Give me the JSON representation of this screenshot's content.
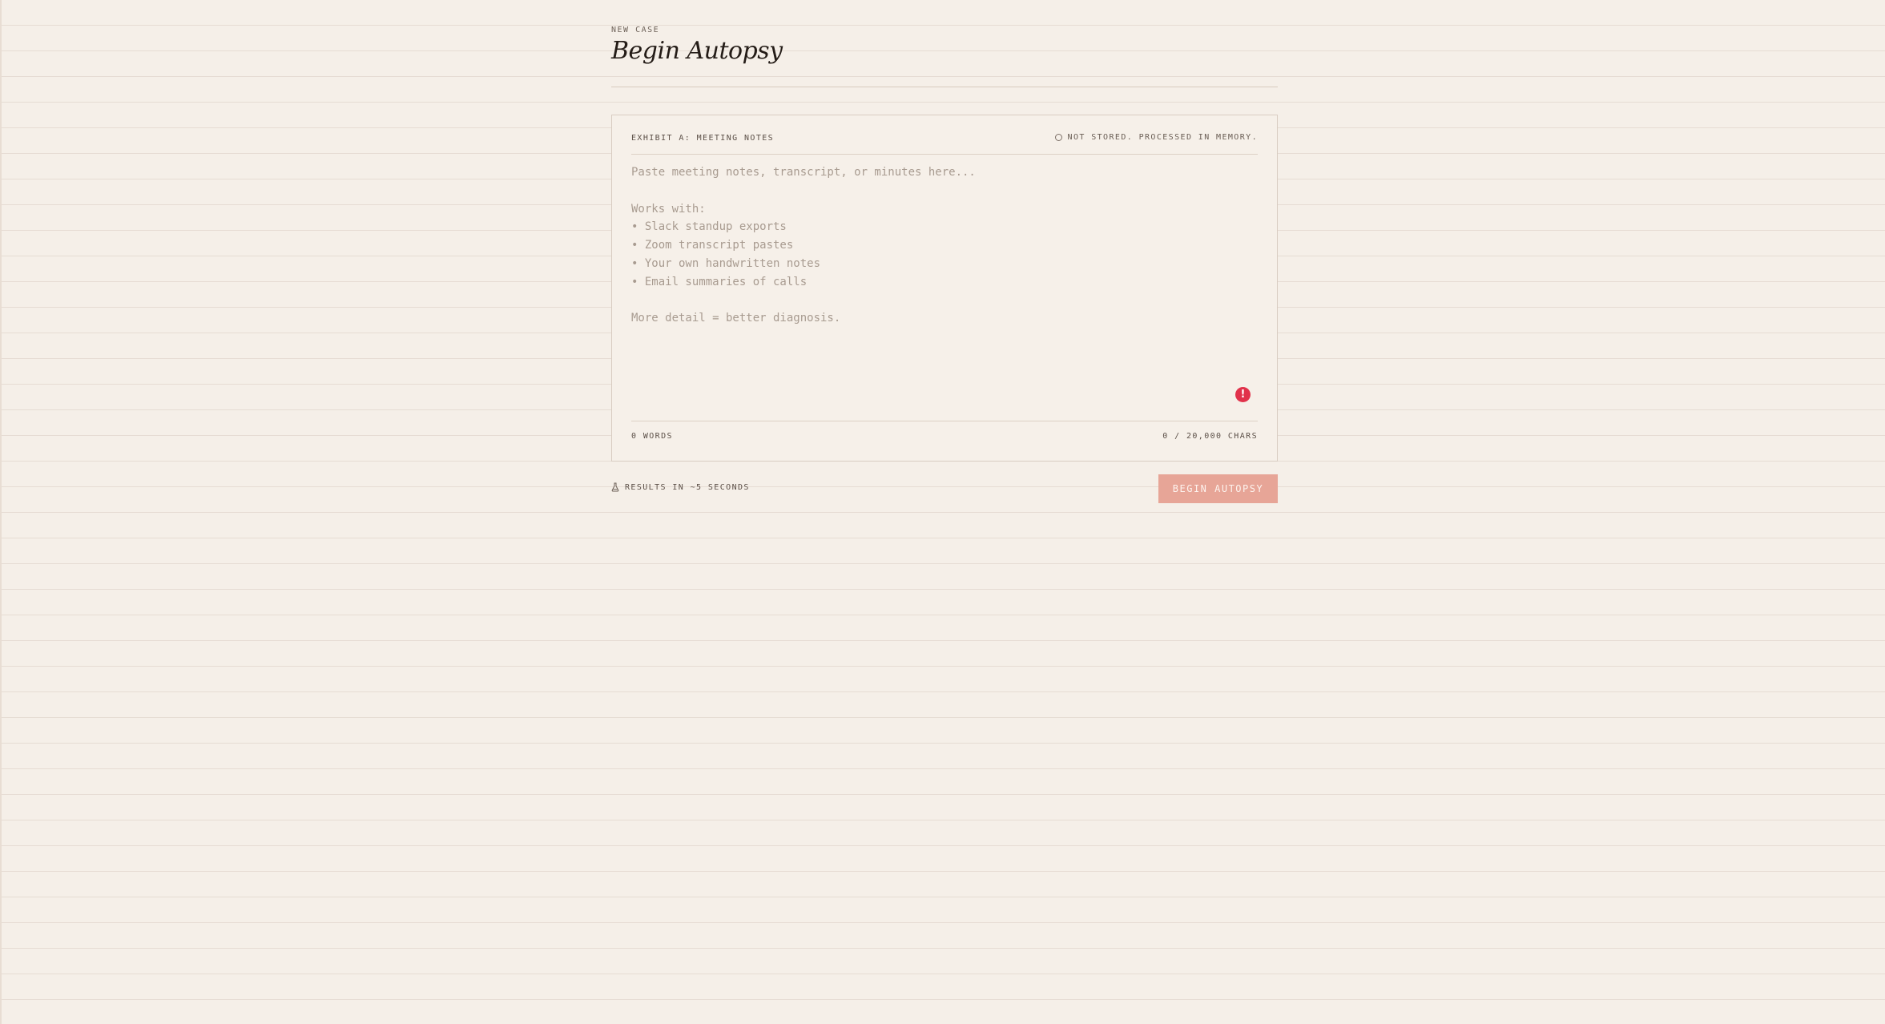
{
  "header": {
    "eyebrow": "NEW CASE",
    "title": "Begin Autopsy"
  },
  "card": {
    "exhibit_label": "EXHIBIT A: MEETING NOTES",
    "privacy_icon": "circle-icon",
    "privacy_text": "NOT STORED. PROCESSED IN MEMORY.",
    "notes": {
      "value": "",
      "placeholder": "Paste meeting notes, transcript, or minutes here...\n\nWorks with:\n• Slack standup exports\n• Zoom transcript pastes\n• Your own handwritten notes\n• Email summaries of calls\n\nMore detail = better diagnosis."
    },
    "error_icon": "exclamation-icon",
    "error_glyph": "!",
    "error_color": "#e1324b",
    "word_count": "0 WORDS",
    "char_count": "0 / 20,000 CHARS"
  },
  "actions": {
    "results_icon": "flask-icon",
    "results_text": "RESULTS IN ~5 SECONDS",
    "begin_label": "BEGIN AUTOPSY",
    "button_color": "#e7a597"
  }
}
